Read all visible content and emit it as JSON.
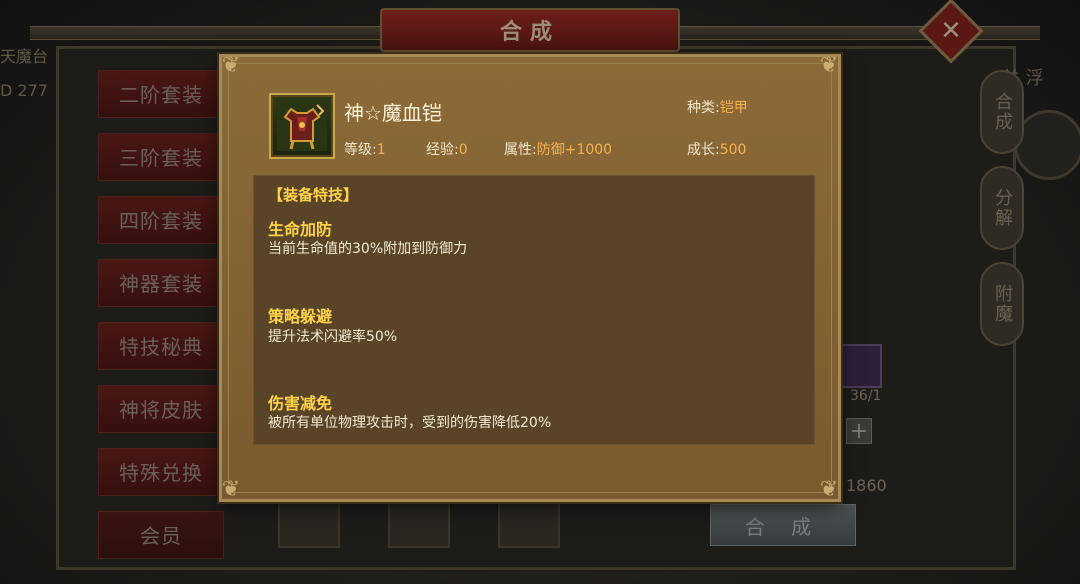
{
  "window": {
    "title": "合成",
    "close_symbol": "✕"
  },
  "background": {
    "left_text": [
      "天魔台",
      "D  277"
    ],
    "right_text": "关 浮",
    "slot_count_text": "36/1",
    "cost_text": "1860",
    "merge_button_label": "合 成"
  },
  "side_menu": [
    {
      "label": "二阶套装"
    },
    {
      "label": "三阶套装"
    },
    {
      "label": "四阶套装"
    },
    {
      "label": "神器套装"
    },
    {
      "label": "特技秘典"
    },
    {
      "label": "神将皮肤"
    },
    {
      "label": "特殊兑换"
    },
    {
      "label": "会员"
    }
  ],
  "right_tabs": [
    {
      "label": "合成"
    },
    {
      "label": "分解"
    },
    {
      "label": "附魔"
    }
  ],
  "item": {
    "name": "神☆魔血铠",
    "level_label": "等级:",
    "level": "1",
    "exp_label": "经验:",
    "exp": "0",
    "attr_label": "属性:",
    "attr": "防御+1000",
    "kind_label": "种类:",
    "kind": "铠甲",
    "growth_label": "成长:",
    "growth": "500"
  },
  "skills_panel": {
    "title": "【装备特技】",
    "skills": [
      {
        "name": "生命加防",
        "desc": "当前生命值的30%附加到防御力"
      },
      {
        "name": "策略躲避",
        "desc": "提升法术闪避率50%"
      },
      {
        "name": "伤害减免",
        "desc": "被所有单位物理攻击时，受到的伤害降低20%"
      }
    ]
  },
  "colors": {
    "dialog_bg": "#8c6a38",
    "panel_bg": "#5a4428",
    "highlight_gold": "#ffd24a",
    "value_orange": "#f6b24c"
  },
  "icons": {
    "item_icon": "armor-icon",
    "close": "close-icon"
  }
}
